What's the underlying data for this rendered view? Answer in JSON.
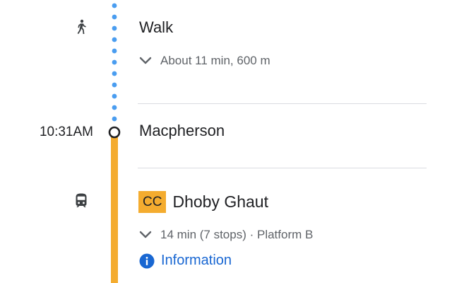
{
  "colors": {
    "walk_dots": "#4a9df0",
    "line_color": "#f4ac2f",
    "link_blue": "#1967d2"
  },
  "walk": {
    "icon": "walk-icon",
    "title": "Walk",
    "detail": "About 11 min, 600 m"
  },
  "stop": {
    "time": "10:31AM",
    "name": "Macpherson"
  },
  "transit": {
    "icon": "train-icon",
    "line_code": "CC",
    "destination": "Dhoby Ghaut",
    "detail": "14 min (7 stops) · Platform B",
    "info_label": "Information"
  }
}
